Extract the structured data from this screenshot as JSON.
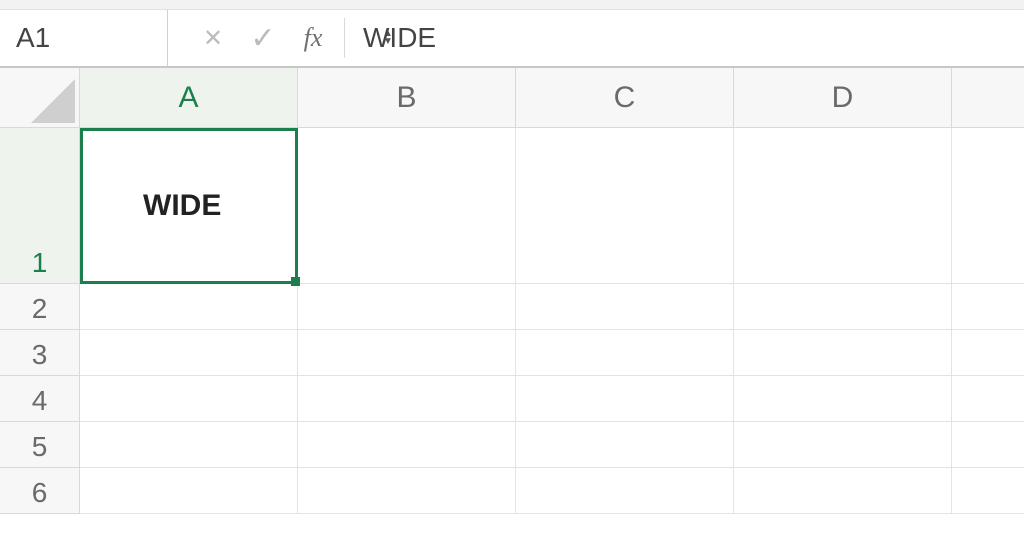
{
  "formula_bar": {
    "name_box": "A1",
    "fx_label": "fx",
    "formula_value": "WIDE"
  },
  "columns": [
    "A",
    "B",
    "C",
    "D"
  ],
  "rows": [
    "1",
    "2",
    "3",
    "4",
    "5",
    "6"
  ],
  "active_cell": {
    "ref": "A1",
    "value": "WIDE"
  },
  "colors": {
    "selection_green": "#1b7f4d",
    "gridline": "#e3e3e3",
    "header_bg": "#f7f7f7"
  }
}
